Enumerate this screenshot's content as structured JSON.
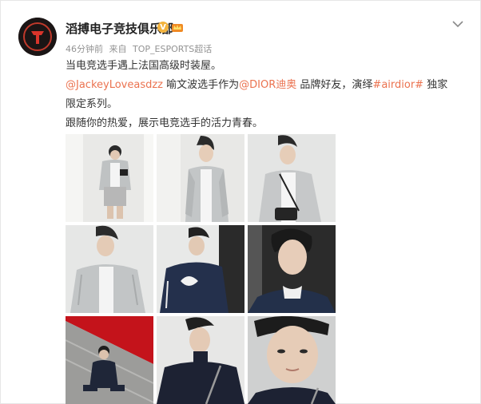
{
  "post": {
    "author": "滔搏电子竞技俱乐部",
    "verified_glyph": "V",
    "time": "46分钟前",
    "source_prefix": "来自",
    "source": "TOP_ESPORTS超话",
    "text_line1": "当电竞选手遇上法国高级时装屋。",
    "mention_user": "@JackeyLoveasdzz",
    "text_mid": " 喻文波选手作为",
    "mention_brand": "@DIOR迪奥",
    "text_mid2": " 品牌好友，演绎",
    "hashtag": "#airdior#",
    "text_end": " 独家",
    "text_line3": "限定系列。",
    "text_line4": "跟随你的热爱，展示电竞选手的活力青春。"
  },
  "icons": {
    "avatar": "team-logo-avatar",
    "verified": "verified-badge-icon",
    "crown": "crown-badge-icon",
    "menu": "chevron-down-icon"
  },
  "colors": {
    "link": "#eb7350",
    "meta": "#939393",
    "verified": "#f3b33d"
  },
  "photos": [
    {
      "name": "photo-1",
      "desc": "full body grey jacket"
    },
    {
      "name": "photo-2",
      "desc": "grey jacket standing"
    },
    {
      "name": "photo-3",
      "desc": "grey jacket with bag"
    },
    {
      "name": "photo-4",
      "desc": "grey jacket close"
    },
    {
      "name": "photo-5",
      "desc": "navy jacket back"
    },
    {
      "name": "photo-6",
      "desc": "navy portrait"
    },
    {
      "name": "photo-7",
      "desc": "sitting on red stairs"
    },
    {
      "name": "photo-8",
      "desc": "black turtleneck"
    },
    {
      "name": "photo-9",
      "desc": "close up face"
    }
  ]
}
